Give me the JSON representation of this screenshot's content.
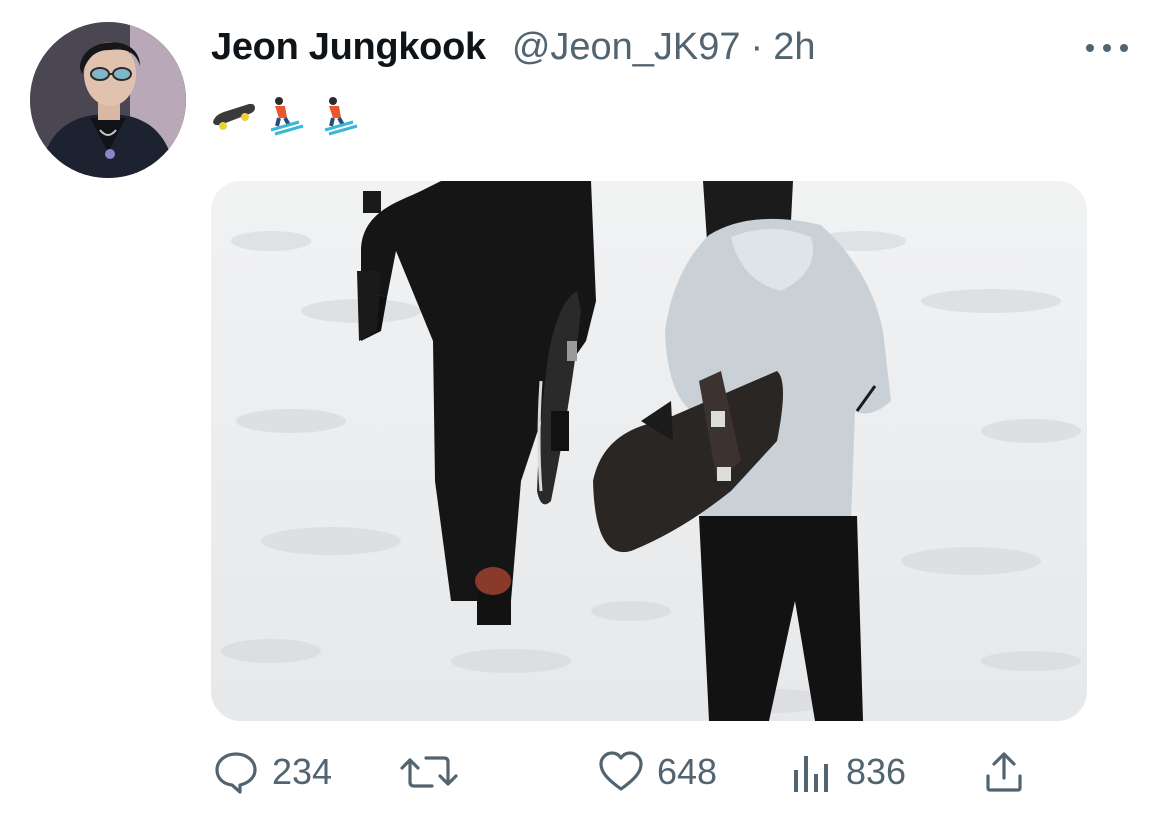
{
  "tweet": {
    "author_name": "Jeon Jungkook",
    "handle": "@Jeon_JK97",
    "separator": "·",
    "time": "2h",
    "emojis": [
      "skateboard",
      "skier",
      "skier"
    ]
  },
  "media": {
    "alt": "Two people in winter clothes walking on snow carrying snowboards"
  },
  "actions": {
    "replies": "234",
    "retweets": "",
    "likes": "648",
    "views": "836"
  },
  "icons": {
    "more": "more-options-icon",
    "reply": "reply-icon",
    "retweet": "retweet-icon",
    "like": "heart-icon",
    "views": "views-chart-icon",
    "share": "share-icon"
  },
  "colors": {
    "text_primary": "#0f1419",
    "text_secondary": "#536471"
  }
}
